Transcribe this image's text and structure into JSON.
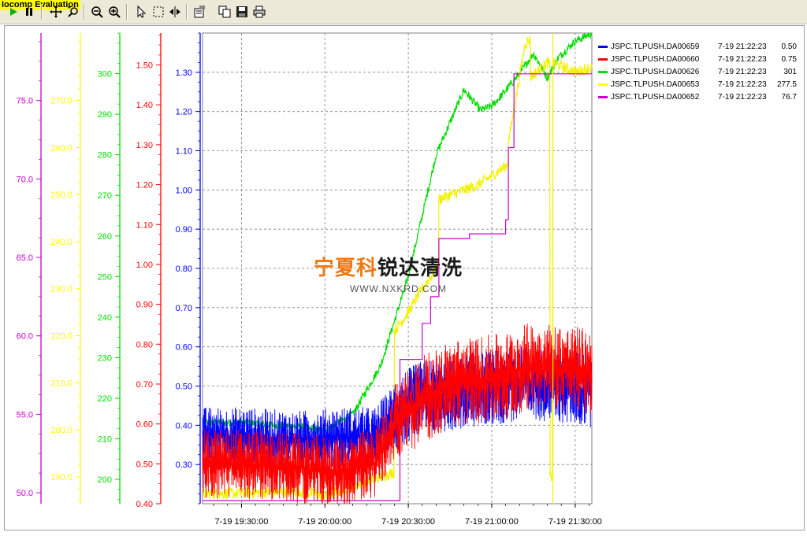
{
  "toolbar": {
    "evaluation_label": "Iocomp Evaluation",
    "buttons": [
      "play",
      "pause",
      "pan",
      "zoom-box",
      "zoom-out",
      "zoom-in",
      "select",
      "cursor-box",
      "cursor-track",
      "properties",
      "copy",
      "save",
      "print"
    ]
  },
  "watermark": {
    "brand_a": "宁夏科",
    "brand_b": "锐达清洗",
    "url": "WWW.NXKRD.COM"
  },
  "legend": [
    {
      "name": "JSPC.TLPUSH.DA00659",
      "time": "7-19 21:22:23",
      "value": "0.50",
      "color": "#0000ff"
    },
    {
      "name": "JSPC.TLPUSH.DA00660",
      "time": "7-19 21:22:23",
      "value": "0.75",
      "color": "#ff0000"
    },
    {
      "name": "JSPC.TLPUSH.DA00626",
      "time": "7-19 21:22:23",
      "value": "301",
      "color": "#00dd00"
    },
    {
      "name": "JSPC.TLPUSH.DA00653",
      "time": "7-19 21:22:23",
      "value": "277.5",
      "color": "#ffff00"
    },
    {
      "name": "JSPC.TLPUSH.DA00652",
      "time": "7-19 21:22:23",
      "value": "76.7",
      "color": "#cc00cc"
    }
  ],
  "colors": {
    "blue": "#0000ff",
    "red": "#ff0000",
    "green": "#00dd00",
    "yellow": "#ffff00",
    "magenta": "#cc00cc",
    "grid": "#808080"
  },
  "chart_data": {
    "type": "line",
    "x_range": [
      "7-19 19:16:00",
      "7-19 21:36:00"
    ],
    "x_ticks": [
      "7-19 19:30:00",
      "7-19 20:00:00",
      "7-19 20:30:00",
      "7-19 21:00:00",
      "7-19 21:30:00"
    ],
    "grid": true,
    "legend_position": "top-right",
    "axes": [
      {
        "id": "magenta",
        "color": "#cc00cc",
        "range": [
          49.3,
          79.3
        ],
        "ticks": [
          "50.0",
          "55.0",
          "60.0",
          "65.0",
          "70.0",
          "75.0"
        ]
      },
      {
        "id": "yellow",
        "color": "#ffff00",
        "range": [
          184.3,
          284.3
        ],
        "ticks": [
          "190.0",
          "200.0",
          "210.0",
          "220.0",
          "230.0",
          "240.0",
          "250.0",
          "260.0",
          "270.0"
        ]
      },
      {
        "id": "green",
        "color": "#00dd00",
        "range": [
          194,
          310
        ],
        "ticks": [
          "200",
          "210",
          "220",
          "230",
          "240",
          "250",
          "260",
          "270",
          "280",
          "290",
          "300"
        ]
      },
      {
        "id": "red",
        "color": "#ff0000",
        "range": [
          0.4,
          1.58
        ],
        "ticks": [
          "0.40",
          "0.50",
          "0.60",
          "0.70",
          "0.80",
          "0.90",
          "1.00",
          "1.10",
          "1.20",
          "1.30",
          "1.40",
          "1.50"
        ]
      },
      {
        "id": "blue",
        "color": "#0000ff",
        "range": [
          0.2,
          1.4
        ],
        "ticks": [
          "0.30",
          "0.40",
          "0.50",
          "0.60",
          "0.70",
          "0.80",
          "0.90",
          "1.00",
          "1.10",
          "1.20",
          "1.30"
        ]
      }
    ],
    "series": [
      {
        "name": "JSPC.TLPUSH.DA00626",
        "axis": "green",
        "noise": 1.0,
        "x": [
          "19:16",
          "19:30",
          "19:50",
          "20:00",
          "20:10",
          "20:20",
          "20:30",
          "20:40",
          "20:50",
          "20:56",
          "21:00",
          "21:04",
          "21:10",
          "21:15",
          "21:20",
          "21:24",
          "21:30",
          "21:36"
        ],
        "y": [
          214,
          214,
          213,
          212,
          216,
          228,
          250,
          280,
          296,
          291,
          292,
          295,
          300,
          305,
          299,
          304,
          308,
          310
        ]
      },
      {
        "name": "JSPC.TLPUSH.DA00653",
        "axis": "yellow",
        "noise": 1.2,
        "x": [
          "19:16",
          "19:30",
          "19:50",
          "20:00",
          "20:20",
          "20:25",
          "20:25",
          "20:30",
          "20:35",
          "20:41",
          "20:41",
          "20:55",
          "21:05",
          "21:06",
          "21:06",
          "21:12",
          "21:14",
          "21:14",
          "21:20",
          "21:21",
          "21:21",
          "21:22",
          "21:22",
          "21:30",
          "21:36"
        ],
        "y": [
          186.5,
          186.5,
          187,
          186,
          190,
          191,
          221,
          225,
          230,
          235,
          249,
          252,
          256,
          257,
          261,
          282,
          283,
          275,
          278,
          278,
          190,
          190,
          278,
          276,
          277
        ]
      },
      {
        "name": "JSPC.TLPUSH.DA00652",
        "axis": "magenta",
        "noise": 0,
        "x": [
          "19:16",
          "20:27",
          "20:27",
          "20:35",
          "20:35",
          "20:38",
          "20:38",
          "20:41",
          "20:41",
          "20:52",
          "20:52",
          "21:05",
          "21:05",
          "21:06",
          "21:06",
          "21:08",
          "21:08",
          "21:36"
        ],
        "y": [
          49.5,
          49.5,
          58.5,
          58.5,
          60.8,
          60.8,
          62.5,
          62.5,
          66.2,
          66.2,
          66.5,
          66.5,
          67.4,
          67.4,
          72,
          72,
          76.7,
          76.7
        ]
      },
      {
        "name": "JSPC.TLPUSH.DA00659",
        "axis": "blue",
        "noise": 0.07,
        "x": [
          "19:16",
          "19:30",
          "19:50",
          "20:05",
          "20:18",
          "20:25",
          "20:35",
          "20:45",
          "20:55",
          "21:05",
          "21:15",
          "21:25",
          "21:36"
        ],
        "y": [
          0.37,
          0.37,
          0.36,
          0.37,
          0.37,
          0.43,
          0.47,
          0.48,
          0.49,
          0.5,
          0.51,
          0.5,
          0.49
        ]
      },
      {
        "name": "JSPC.TLPUSH.DA00660",
        "axis": "red",
        "noise": 0.08,
        "x": [
          "19:16",
          "19:30",
          "19:50",
          "20:05",
          "20:18",
          "20:25",
          "20:35",
          "20:45",
          "20:55",
          "21:05",
          "21:15",
          "21:25",
          "21:36"
        ],
        "y": [
          0.5,
          0.5,
          0.49,
          0.48,
          0.5,
          0.6,
          0.66,
          0.7,
          0.71,
          0.72,
          0.75,
          0.74,
          0.73
        ]
      }
    ]
  }
}
